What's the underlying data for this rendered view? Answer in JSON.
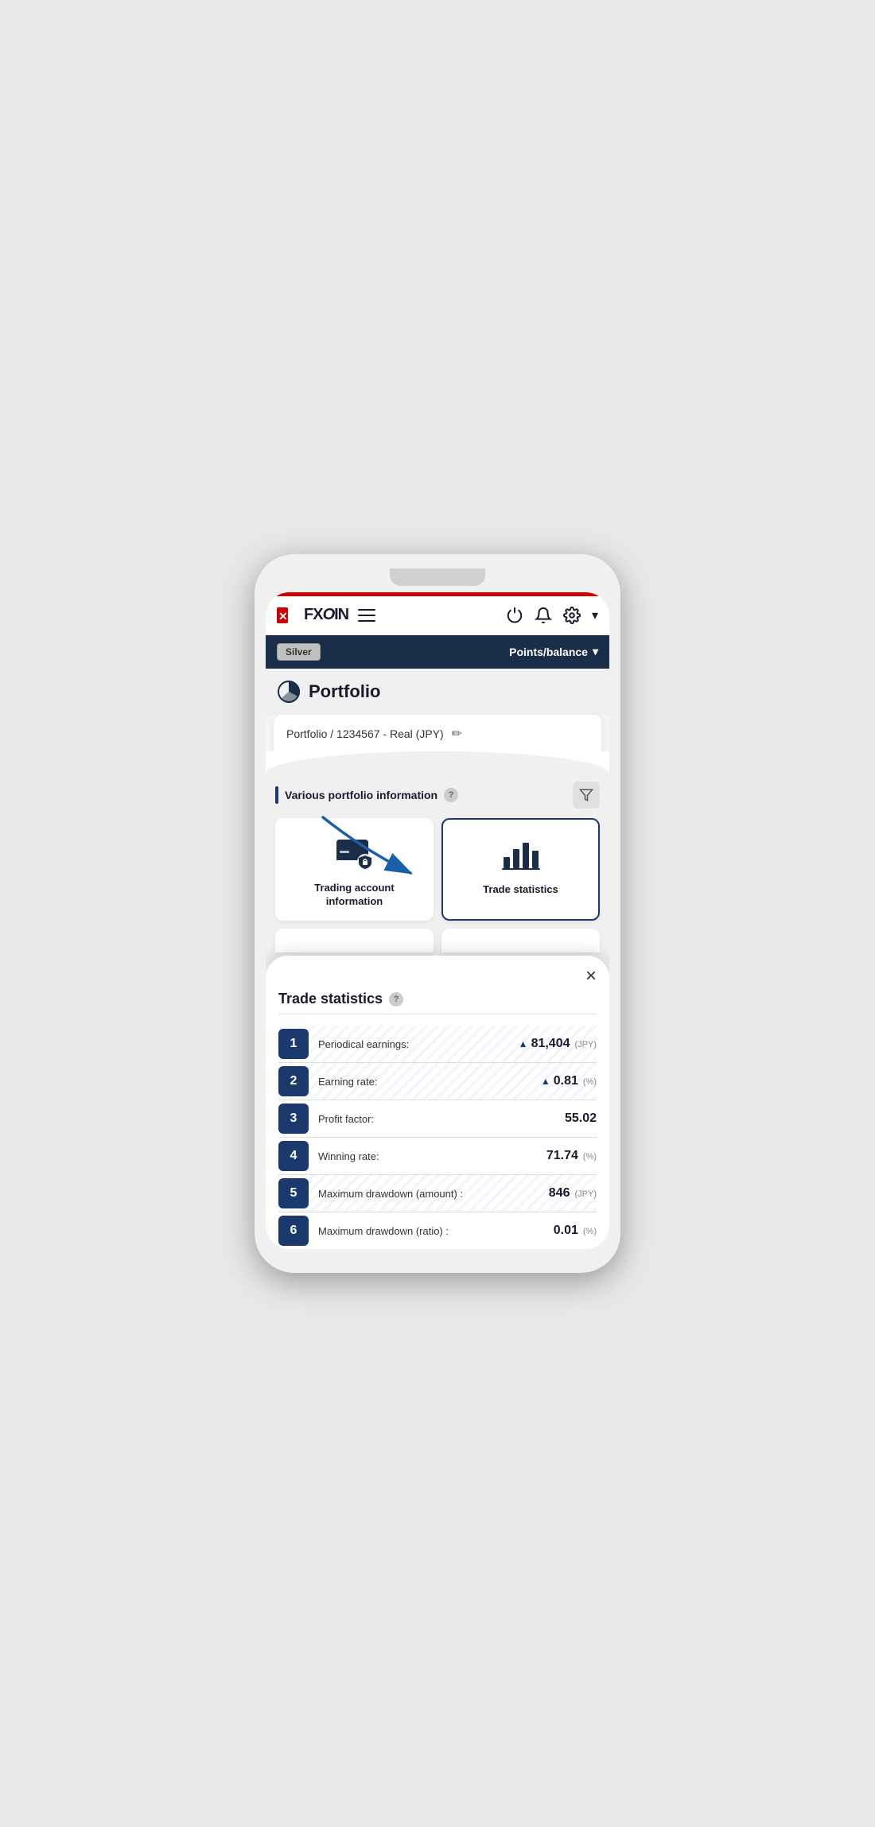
{
  "app": {
    "logo": "FXON",
    "logo_x": "✕",
    "red_bar_color": "#cc0000"
  },
  "header": {
    "hamburger_label": "menu",
    "power_icon": "⏻",
    "bell_icon": "🔔",
    "gear_icon": "⚙",
    "chevron_icon": "▾"
  },
  "sub_header": {
    "silver_label": "Silver",
    "points_balance_label": "Points/balance",
    "chevron": "▾"
  },
  "page_title": {
    "title": "Portfolio"
  },
  "portfolio_card": {
    "breadcrumb": "Portfolio / 1234567 - Real (JPY)",
    "edit_icon": "✏"
  },
  "section": {
    "title": "Various portfolio information",
    "help_icon": "?",
    "filter_icon": "⊿"
  },
  "cards": [
    {
      "id": "trading-account",
      "label": "Trading account\ninformation",
      "highlighted": false
    },
    {
      "id": "trade-statistics",
      "label": "Trade statistics",
      "highlighted": true
    }
  ],
  "modal": {
    "close_label": "×",
    "title": "Trade statistics",
    "help_icon": "?",
    "stats": [
      {
        "number": "1",
        "label": "Periodical earnings:",
        "arrow": "▲",
        "value": "81,404",
        "unit": "(JPY)",
        "striped": true
      },
      {
        "number": "2",
        "label": "Earning rate:",
        "arrow": "▲",
        "value": "0.81",
        "unit": "(%)",
        "striped": true
      },
      {
        "number": "3",
        "label": "Profit factor:",
        "arrow": "",
        "value": "55.02",
        "unit": "",
        "striped": false
      },
      {
        "number": "4",
        "label": "Winning rate:",
        "arrow": "",
        "value": "71.74",
        "unit": "(%)",
        "striped": false
      },
      {
        "number": "5",
        "label": "Maximum drawdown (amount) :",
        "arrow": "",
        "value": "846",
        "unit": "(JPY)",
        "striped": true
      },
      {
        "number": "6",
        "label": "Maximum drawdown (ratio) :",
        "arrow": "",
        "value": "0.01",
        "unit": "(%)",
        "striped": false
      }
    ]
  }
}
